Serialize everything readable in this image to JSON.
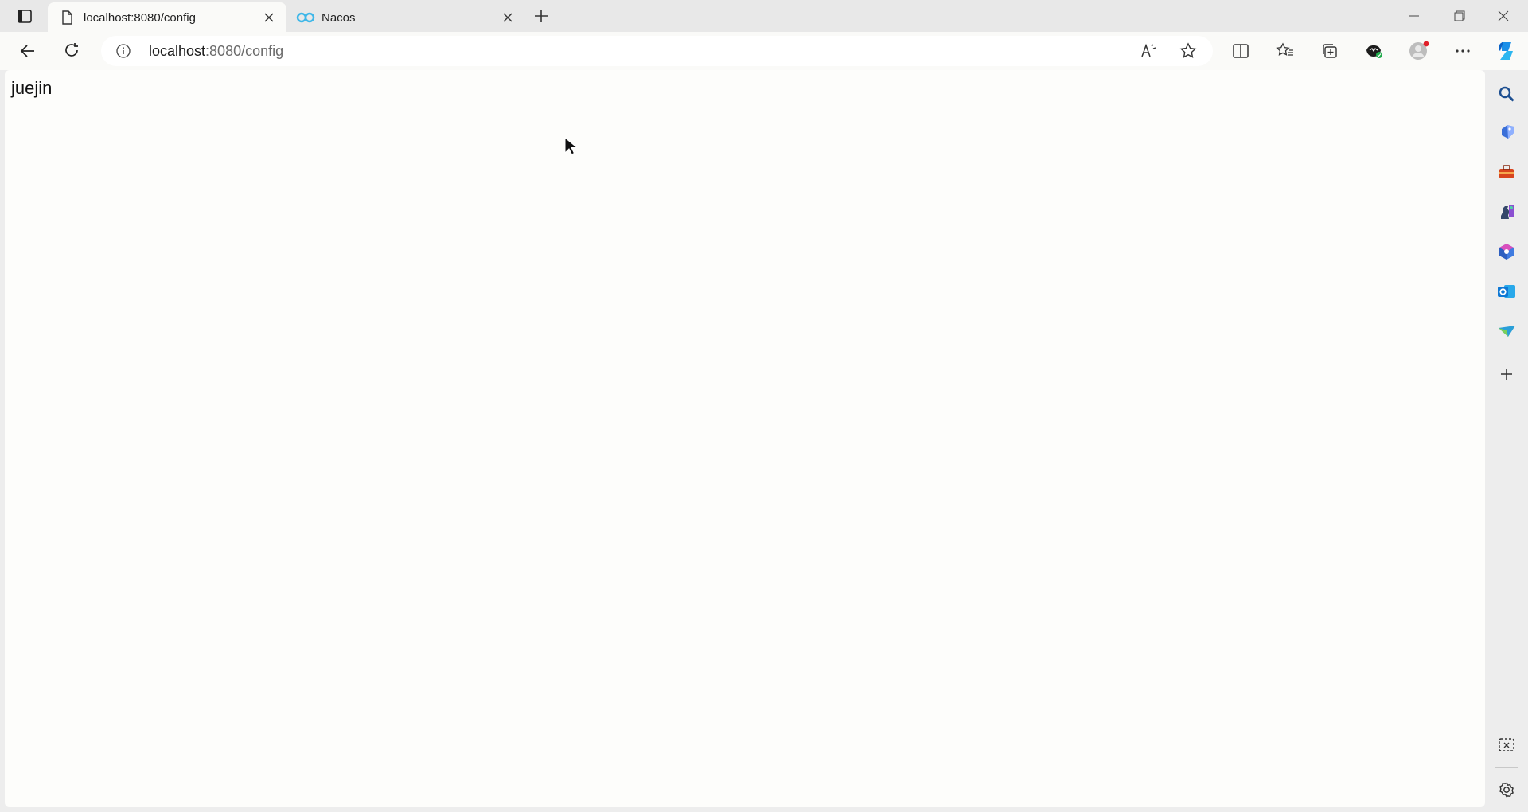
{
  "tabs": [
    {
      "title": "localhost:8080/config",
      "active": true,
      "favicon": "page-icon"
    },
    {
      "title": "Nacos",
      "active": false,
      "favicon": "nacos-logo-icon"
    }
  ],
  "address_bar": {
    "host": "localhost",
    "path": ":8080/config"
  },
  "page": {
    "body_text": "juejin"
  },
  "toolbar_icons": [
    "back-icon",
    "refresh-icon",
    "site-info-icon",
    "read-aloud-icon",
    "add-favorite-icon",
    "split-screen-icon",
    "favorites-icon",
    "collections-icon",
    "browser-essentials-icon",
    "profile-avatar",
    "more-options-icon",
    "copilot-icon"
  ],
  "sidebar_icons": [
    "search-icon",
    "shopping-icon",
    "tools-icon",
    "games-icon",
    "microsoft-365-icon",
    "outlook-icon",
    "send-icon",
    "add-icon",
    "screenshot-icon",
    "settings-icon"
  ],
  "colors": {
    "chrome_bg": "#e8e8e8",
    "toolbar_bg": "#fafaf8",
    "page_bg": "#fdfdfb",
    "copilot": "#1b8fe8",
    "outlook": "#0f78d4"
  }
}
